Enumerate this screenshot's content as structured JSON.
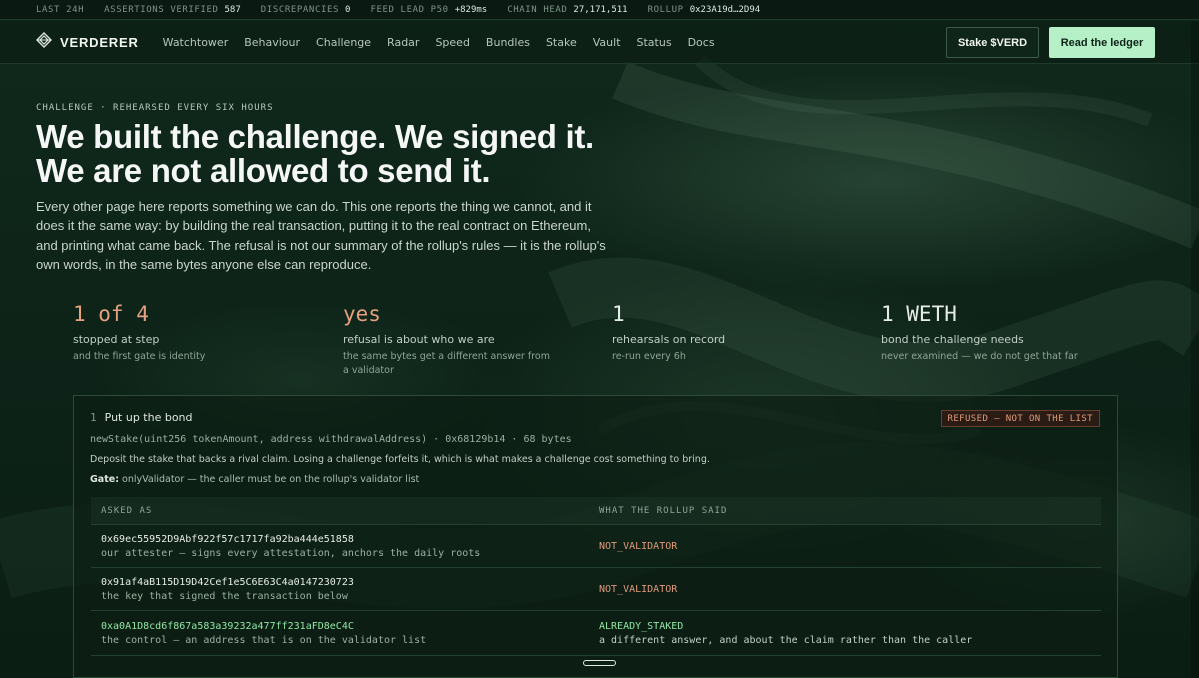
{
  "ticker": [
    {
      "label": "LAST 24H",
      "value": ""
    },
    {
      "label": "ASSERTIONS VERIFIED",
      "value": "587"
    },
    {
      "label": "DISCREPANCIES",
      "value": "0"
    },
    {
      "label": "FEED LEAD P50",
      "value": "+829ms"
    },
    {
      "label": "CHAIN HEAD",
      "value": "27,171,511"
    },
    {
      "label": "ROLLUP",
      "value": "0x23A19d…2D94"
    }
  ],
  "nav": {
    "brand": "VERDERER",
    "links": [
      "Watchtower",
      "Behaviour",
      "Challenge",
      "Radar",
      "Speed",
      "Bundles",
      "Stake",
      "Vault",
      "Status",
      "Docs"
    ],
    "stake_button": "Stake $VERD",
    "ledger_button": "Read the ledger"
  },
  "hero": {
    "eyebrow": "CHALLENGE · REHEARSED EVERY SIX HOURS",
    "title": "We built the challenge. We signed it. We are not allowed to send it.",
    "body": "Every other page here reports something we can do. This one reports the thing we cannot, and it does it the same way: by building the real transaction, putting it to the real contract on Ethereum, and printing what came back. The refusal is not our summary of the rollup's rules — it is the rollup's own words, in the same bytes anyone else can reproduce."
  },
  "stats": [
    {
      "big": "1 of 4",
      "label": "stopped at step",
      "sub": "and the first gate is identity",
      "accent": true
    },
    {
      "big": "yes",
      "label": "refusal is about who we are",
      "sub": "the same bytes get a different answer from a validator",
      "accent": true
    },
    {
      "big": "1",
      "label": "rehearsals on record",
      "sub": "re-run every 6h",
      "accent": false
    },
    {
      "big": "1 WETH",
      "label": "bond the challenge needs",
      "sub": "never examined — we do not get that far",
      "accent": false
    }
  ],
  "step": {
    "number": "1",
    "title": "Put up the bond",
    "badge": "REFUSED — NOT ON THE LIST",
    "signature": "newStake(uint256 tokenAmount, address withdrawalAddress) · 0x68129b14 · 68 bytes",
    "description": "Deposit the stake that backs a rival claim. Losing a challenge forfeits it, which is what makes a challenge cost something to bring.",
    "gate_label": "Gate:",
    "gate_text": " onlyValidator — the caller must be on the rollup's validator list"
  },
  "table": {
    "headers": [
      "ASKED AS",
      "WHAT THE ROLLUP SAID"
    ],
    "rows": [
      {
        "address": "0x69ec55952D9Abf922f57c1717fa92ba444e51858",
        "note": "our attester — signs every attestation, anchors the daily roots",
        "said": "NOT_VALIDATOR",
        "said_note": ""
      },
      {
        "address": "0x91af4aB115D19D42Cef1e5C6E63C4a0147230723",
        "note": "the key that signed the transaction below",
        "said": "NOT_VALIDATOR",
        "said_note": ""
      },
      {
        "address": "0xa0A1D8cd6f867a583a39232a477ff231aFD8eC4C",
        "note": "the control — an address that is on the validator list",
        "said": "ALREADY_STAKED",
        "said_note": "a different answer, and about the claim rather than the caller"
      }
    ]
  },
  "colors": {
    "background": "#0d2117",
    "accent_orange": "#e5a07e",
    "accent_green": "#8fe6a7",
    "cta": "#b6f0c7"
  }
}
